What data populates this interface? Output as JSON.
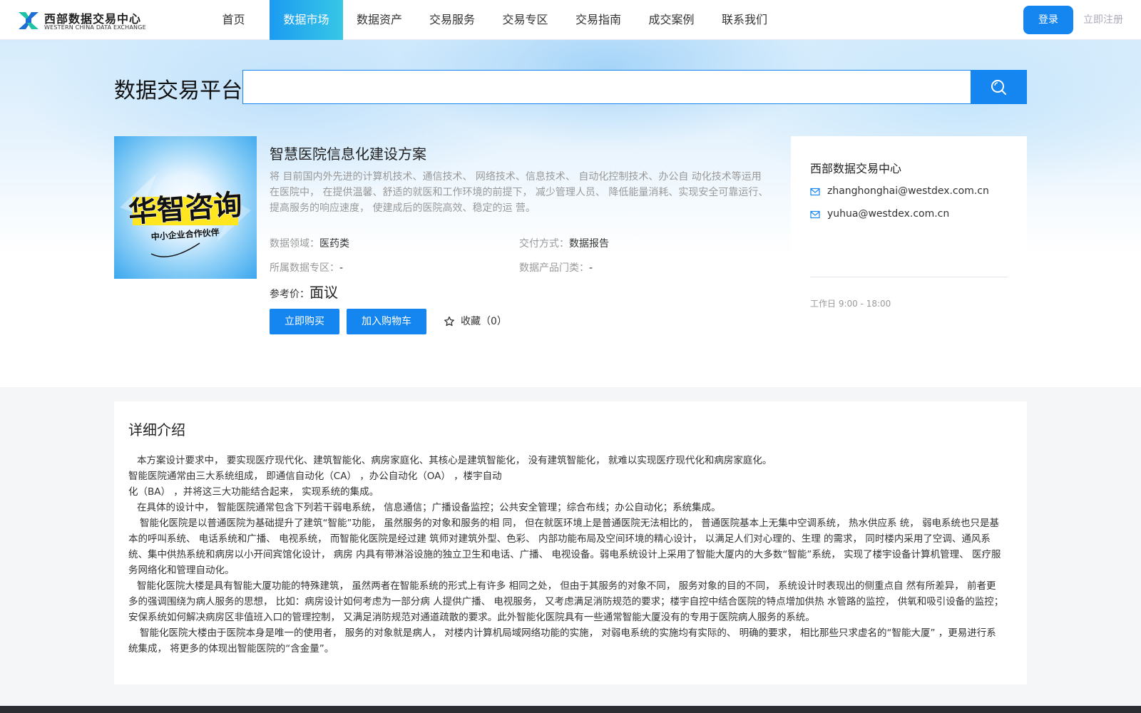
{
  "header": {
    "logo_name": "西部数据交易中心",
    "logo_sub": "WESTERN CHINA DATA EXCHANGE",
    "nav": [
      {
        "label": "首页",
        "active": false
      },
      {
        "label": "数据市场",
        "active": true
      },
      {
        "label": "数据资产",
        "active": false
      },
      {
        "label": "交易服务",
        "active": false
      },
      {
        "label": "交易专区",
        "active": false
      },
      {
        "label": "交易指南",
        "active": false
      },
      {
        "label": "成交案例",
        "active": false
      },
      {
        "label": "联系我们",
        "active": false
      }
    ],
    "login_label": "登录",
    "register_label": "立即注册"
  },
  "search": {
    "title": "数据交易平台",
    "value": "",
    "icon": "search-icon"
  },
  "product": {
    "image_text_main": "华智咨询",
    "image_text_sub": "中小企业合作伙伴",
    "title": "智慧医院信息化建设方案",
    "description": "将 目前国内外先进的计算机技术、通信技术、 网络技术、信息技术、 自动化控制技术、办公自 动化技术等运用在医院中， 在提供温馨、舒适的就医和工作环境的前提下， 减少管理人员、 降低能量消耗、实现安全可靠运行、提高服务的响应速度， 使建成后的医院高效、稳定的运 营。",
    "meta": {
      "field_label": "数据领域：",
      "field_value": "医药类",
      "delivery_label": "交付方式：",
      "delivery_value": "数据报告",
      "zone_label": "所属数据专区：",
      "zone_value": "-",
      "category_label": "数据产品门类：",
      "category_value": "-"
    },
    "price_label": "参考价：",
    "price_value": "面议",
    "buy_label": "立即购买",
    "cart_label": "加入购物车",
    "favorite_label": "收藏（0）",
    "favorite_icon": "star-icon"
  },
  "contact": {
    "name": "西部数据交易中心",
    "emails": [
      "zhanghonghai@westdex.com.cn",
      "yuhua@westdex.com.cn"
    ],
    "email_icon": "mail-icon",
    "hours": "工作日 9:00 - 18:00"
  },
  "details": {
    "title": "详细介绍",
    "paragraphs": [
      "本方案设计要求中， 要实现医疗现代化、建筑智能化、病房家庭化、其核心是建筑智能化， 没有建筑智能化， 就难以实现医疗现代化和病房家庭化。",
      "智能医院通常由三大系统组成， 即通信自动化（CA） ，办公自动化（OA） ，楼宇自动",
      "化（BA） ，并将这三大功能结合起来， 实现系统的集成。",
      "在具体的设计中， 智能医院通常包含下列若干弱电系统， 信息通信；广播设备监控；公共安全管理；综合布线；办公自动化；系统集成。",
      "智能化医院是以普通医院为基础提升了建筑“智能”功能， 虽然服务的对象和服务的相 同， 但在就医环境上是普通医院无法相比的， 普通医院基本上无集中空调系统， 热水供应系 统， 弱电系统也只是基本的呼叫系统、 电话系统和广播、 电视系统， 而智能化医院是经过建 筑师对建筑外型、色彩、 内部功能布局及空间环境的精心设计， 以满足人们对心理的、生理 的需求， 同时楼内采用了空调、通风系统、集中供热系统和病房以小开间宾馆化设计， 病房 内具有带淋浴设施的独立卫生和电话、广播、 电视设备。弱电系统设计上采用了智能大厦内的大多数“智能”系统， 实现了楼宇设备计算机管理、 医疗服务网络化和管理自动化。",
      "智能化医院大楼是具有智能大厦功能的特殊建筑， 虽然两者在智能系统的形式上有许多 相同之处， 但由于其服务的对象不同， 服务对象的目的不同， 系统设计时表现出的侧重点自 然有所差异， 前者更多的强调围绕为病人服务的思想， 比如：病房设计如何考虑为一部分病 人提供广播、 电视服务， 又考虑满足消防规范的要求；楼宇自控中结合医院的特点增加供热 水管路的监控， 供氧和吸引设备的监控；安保系统如何解决病房区非值班入口的管理控制， 又满足消防规范对通道疏散的要求。此外智能化医院具有一些通常智能大厦没有的专用于医院病人服务的系统。",
      "智能化医院大楼由于医院本身是唯一的使用者， 服务的对象就是病人， 对楼内计算机局域网络功能的实施， 对弱电系统的实施均有实际的、 明确的要求， 相比那些只求虚名的“智能大厦” ，更易进行系统集成， 将更多的体现出智能医院的“含金量”。"
    ]
  },
  "colors": {
    "primary": "#1585ef",
    "nav_active_start": "#1c9bf0",
    "nav_active_end": "#37c7e7",
    "logo_blue": "#1f6fd6",
    "logo_green": "#21c3a6",
    "footer": "#2b2d33"
  }
}
